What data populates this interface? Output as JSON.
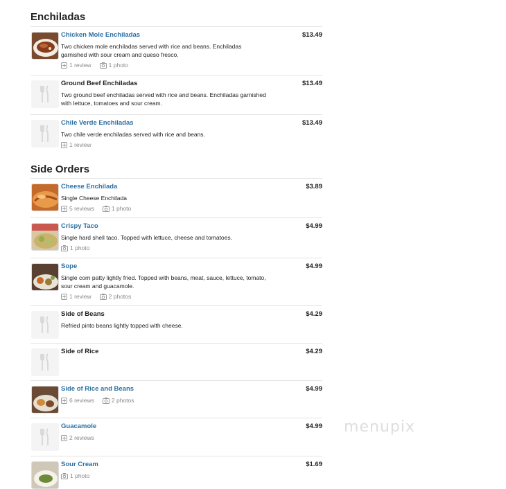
{
  "sections": [
    {
      "title": "Enchiladas",
      "items": [
        {
          "name": "Chicken Mole Enchiladas",
          "price": "$13.49",
          "desc": "Two chicken mole enchiladas served with rice and beans. Enchiladas garnished with sour cream and queso fresco.",
          "reviews": "1 review",
          "photos": "1 photo"
        },
        {
          "name": "Ground Beef Enchiladas",
          "price": "$13.49",
          "desc": "Two ground beef enchiladas served with rice and beans. Enchiladas garnished with lettuce, tomatoes and sour cream."
        },
        {
          "name": "Chile Verde Enchiladas",
          "price": "$13.49",
          "desc": "Two chile verde enchiladas served with rice and beans.",
          "reviews": "1 review"
        }
      ]
    },
    {
      "title": "Side Orders",
      "items": [
        {
          "name": "Cheese Enchilada",
          "price": "$3.89",
          "desc": "Single Cheese Enchilada",
          "reviews": "5 reviews",
          "photos": "1 photo"
        },
        {
          "name": "Crispy Taco",
          "price": "$4.99",
          "desc": "Single hard shell taco. Topped with lettuce, cheese and tomatoes.",
          "photos": "1 photo"
        },
        {
          "name": "Sope",
          "price": "$4.99",
          "desc": "Single corn patty lightly fried. Topped with beans, meat, sauce, lettuce, tomato, sour cream and guacamole.",
          "reviews": "1 review",
          "photos": "2 photos"
        },
        {
          "name": "Side of Beans",
          "price": "$4.29",
          "desc": "Refried pinto beans lightly topped with cheese."
        },
        {
          "name": "Side of Rice",
          "price": "$4.29"
        },
        {
          "name": "Side of Rice and Beans",
          "price": "$4.99",
          "reviews": "6 reviews",
          "photos": "2 photos"
        },
        {
          "name": "Guacamole",
          "price": "$4.99",
          "reviews": "2 reviews"
        },
        {
          "name": "Sour Cream",
          "price": "$1.69",
          "photos": "1 photo"
        }
      ]
    }
  ],
  "watermark": "menupix",
  "colors": {
    "link": "#2a6fa3",
    "text": "#222222",
    "meta": "#888888",
    "divider": "#e3e3e3"
  },
  "icons": {
    "review": "review-icon",
    "photo": "camera-icon",
    "placeholder": "fork-knife-icon"
  }
}
